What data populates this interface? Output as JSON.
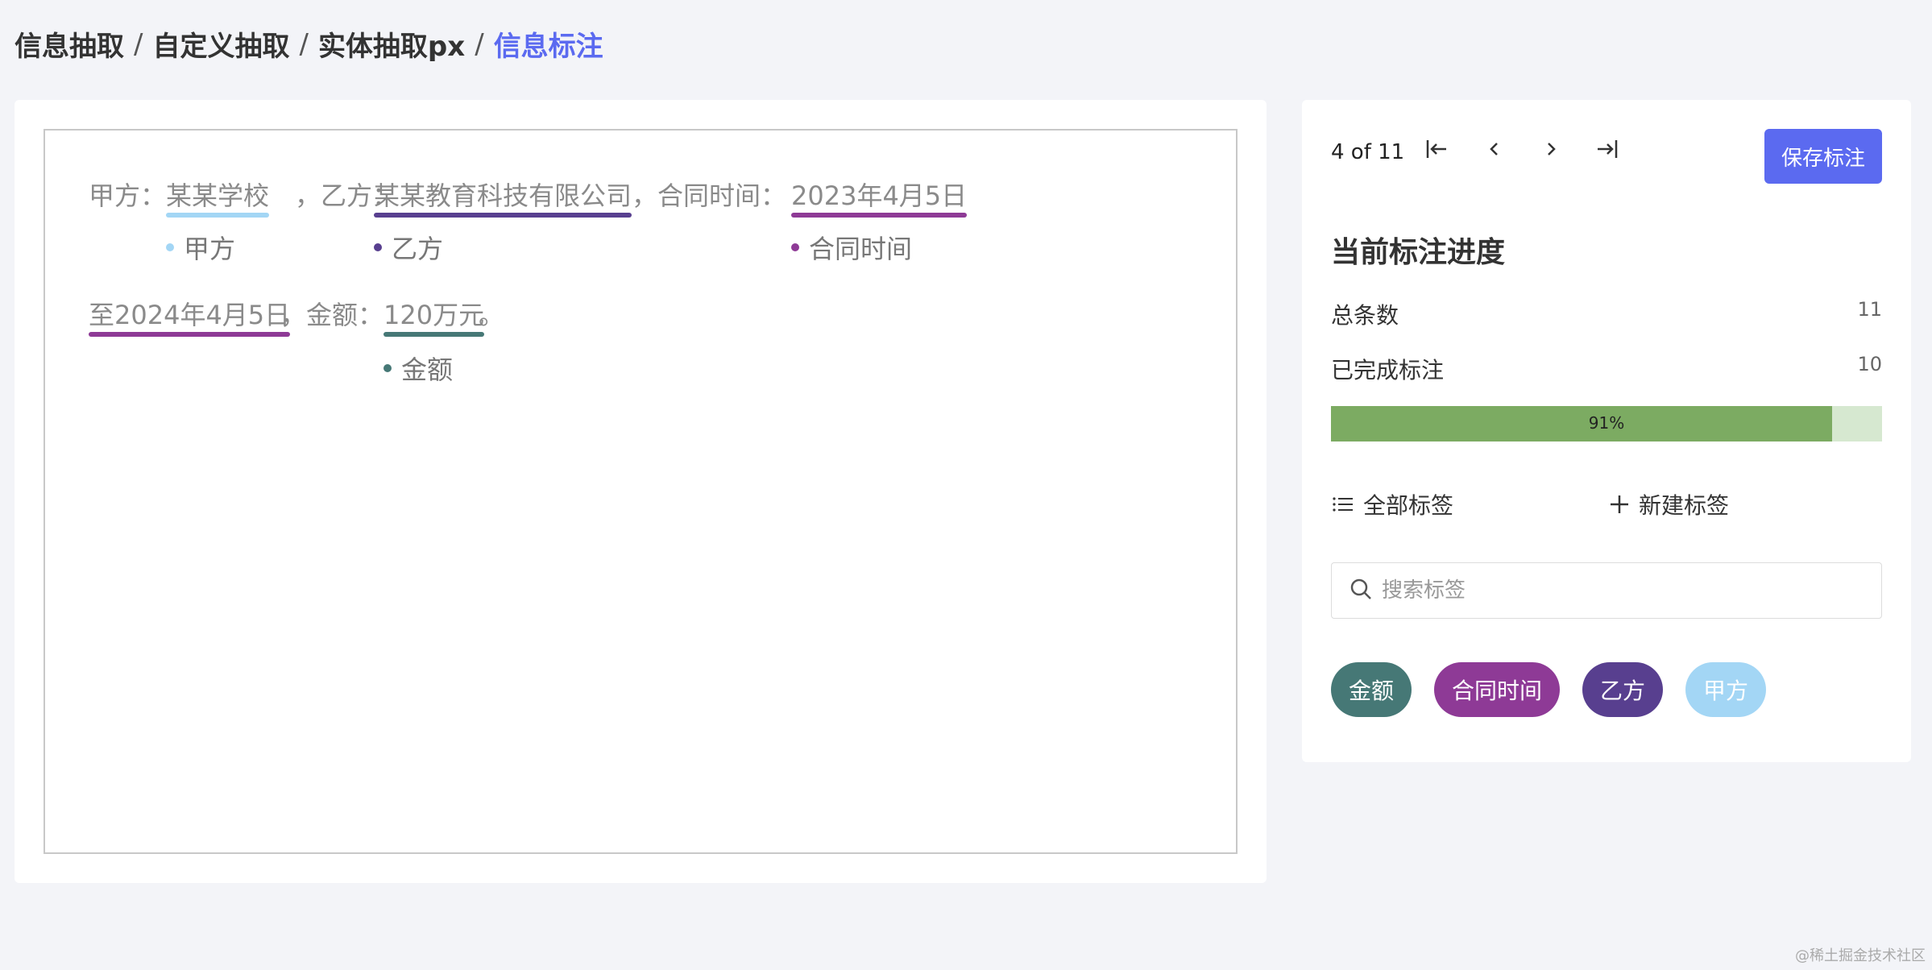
{
  "breadcrumb": {
    "items": [
      "信息抽取",
      "自定义抽取",
      "实体抽取px"
    ],
    "current": "信息标注",
    "separator": "/"
  },
  "editor": {
    "line1": {
      "seg1": "甲方：",
      "ent1": "某某学校",
      "seg2": "，乙方：",
      "ent2": "某某教育科技有限公司",
      "seg3": "，合同时间：",
      "ent3": "2023年4月5日"
    },
    "line1_labels": {
      "l1": "甲方",
      "l2": "乙方",
      "l3": "合同时间"
    },
    "line2": {
      "ent1": "至2024年4月5日",
      "seg1": "，金额：",
      "ent2": "120万元",
      "seg2": "。"
    },
    "line2_labels": {
      "l1": "金额"
    }
  },
  "pager": {
    "text": "4 of 11"
  },
  "toolbar": {
    "save_label": "保存标注"
  },
  "progress": {
    "title": "当前标注进度",
    "total_label": "总条数",
    "total_value": "11",
    "done_label": "已完成标注",
    "done_value": "10",
    "percent_text": "91%",
    "percent": 0.91
  },
  "actions": {
    "all_tags": "全部标签",
    "new_tag": "新建标签"
  },
  "search": {
    "placeholder": "搜索标签",
    "value": ""
  },
  "tags": [
    {
      "label": "金额",
      "color": "#467876"
    },
    {
      "label": "合同时间",
      "color": "#8e3a96"
    },
    {
      "label": "乙方",
      "color": "#583f8f"
    },
    {
      "label": "甲方",
      "color": "#a3d6f5"
    }
  ],
  "colors": {
    "accent": "#5b6af0",
    "progress_fill": "#7cab62",
    "progress_track": "#d6e8d0"
  },
  "watermark": "@稀土掘金技术社区"
}
